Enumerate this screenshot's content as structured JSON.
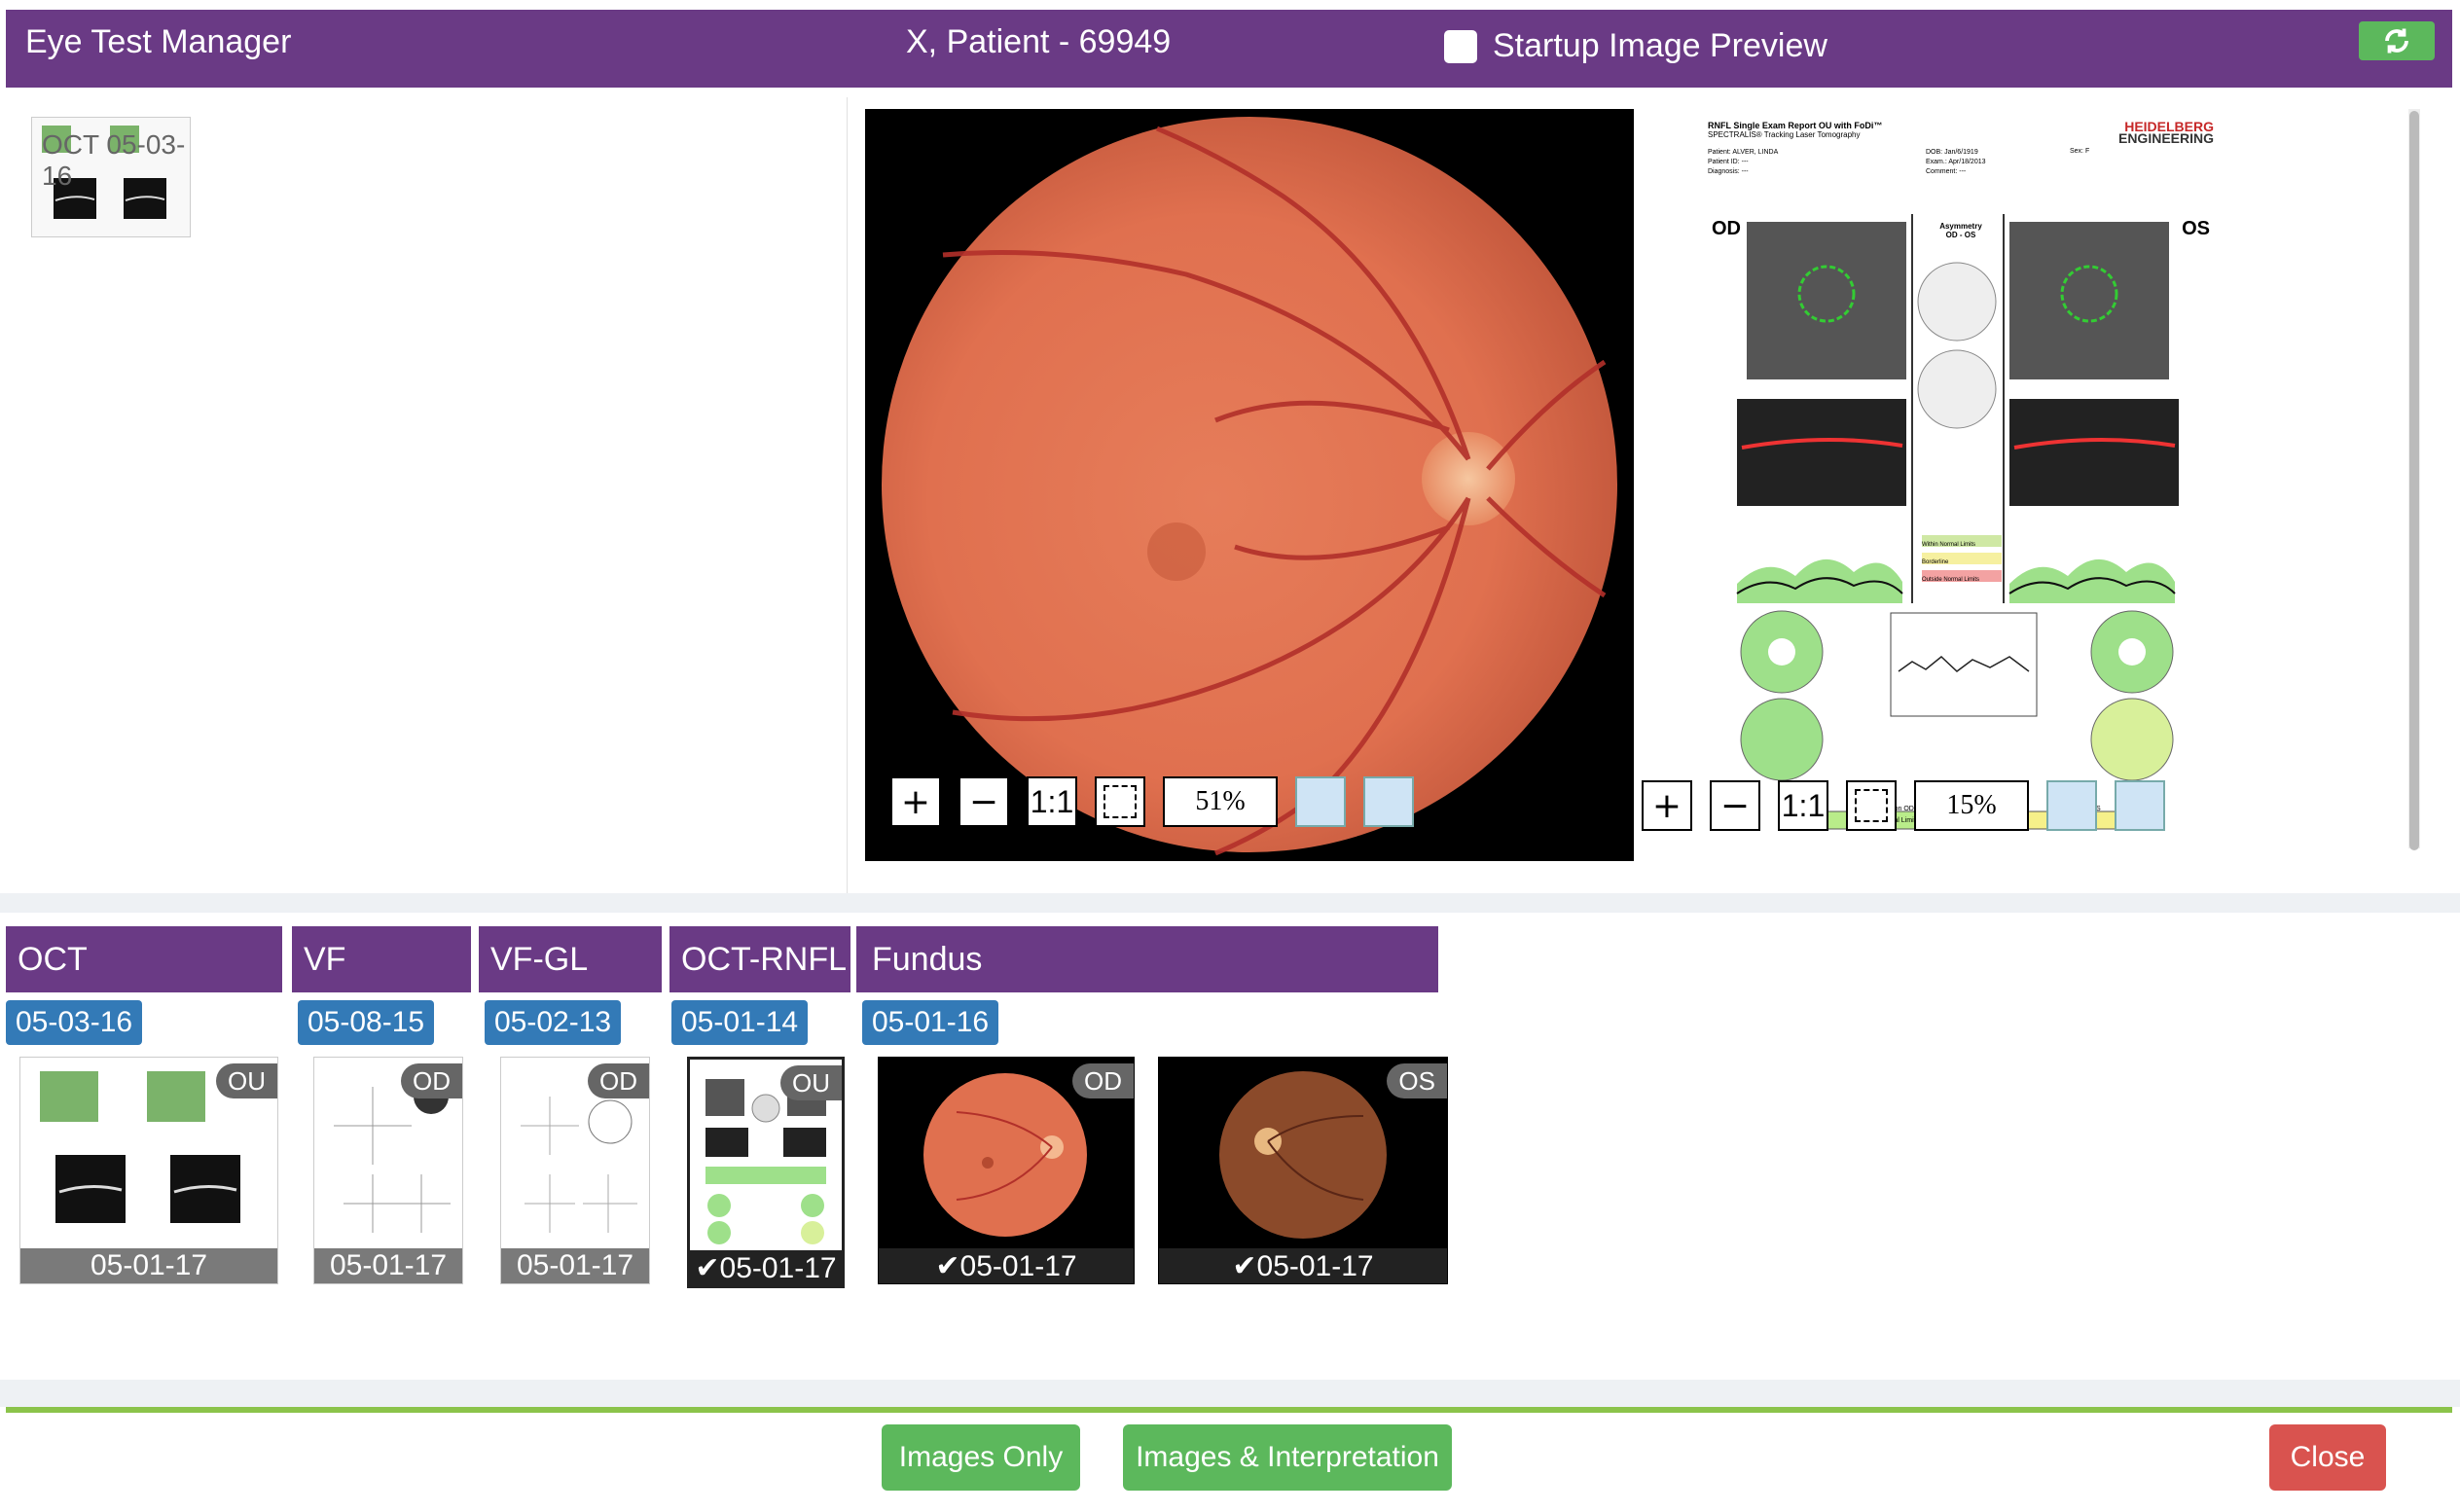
{
  "header": {
    "app_title": "Eye Test Manager",
    "patient": "X, Patient - 69949",
    "startup_preview_label": "Startup Image Preview",
    "colors": {
      "header_bg": "#6a3a85",
      "refresh_bg": "#5cb85c"
    }
  },
  "thumb_panel": {
    "doc_label": "OCT 05-03-16"
  },
  "viewer_left": {
    "zoom": "51%",
    "one_to_one": "1:1"
  },
  "viewer_right": {
    "zoom": "15%",
    "one_to_one": "1:1",
    "report": {
      "title": "RNFL Single Exam Report OU with FoDi™",
      "subtitle": "SPECTRALIS® Tracking Laser Tomography",
      "brand_line1": "HEIDELBERG",
      "brand_line2": "ENGINEERING",
      "fields": [
        {
          "label": "Patient:",
          "value": "ALVER, LINDA"
        },
        {
          "label": "Patient ID:",
          "value": "---"
        },
        {
          "label": "Diagnosis:",
          "value": "---"
        }
      ],
      "fields2": [
        {
          "label": "DOB:",
          "value": "Jan/6/1919"
        },
        {
          "label": "Exam.:",
          "value": "Apr/18/2013"
        },
        {
          "label": "Comment:",
          "value": "---"
        }
      ],
      "sex_label": "Sex:",
      "sex_value": "F",
      "od": "OD",
      "os": "OS",
      "asymmetry": "Asymmetry",
      "asymmetry_sub": "OD - OS",
      "legend_within": "Within Normal Limits",
      "legend_borderline": "Borderline",
      "legend_outside": "Outside Normal Limits",
      "class_od_label": "Classification OD",
      "class_od_value": "Within Normal Limits",
      "class_os_label": "Classification OS",
      "class_os_value": "Borderline"
    }
  },
  "tabs": [
    {
      "label": "OCT",
      "date": "05-03-16"
    },
    {
      "label": "VF",
      "date": "05-08-15"
    },
    {
      "label": "VF-GL",
      "date": "05-02-13"
    },
    {
      "label": "OCT-RNFL",
      "date": "05-01-14"
    },
    {
      "label": "Fundus",
      "date": "05-01-16"
    }
  ],
  "cards": [
    {
      "eye": "OU",
      "date": "05-01-17"
    },
    {
      "eye": "OD",
      "date": "05-01-17"
    },
    {
      "eye": "OD",
      "date": "05-01-17"
    },
    {
      "eye": "OU",
      "date": "✔05-01-17"
    },
    {
      "eye": "OD",
      "date": "✔05-01-17"
    },
    {
      "eye": "OS",
      "date": "✔05-01-17"
    }
  ],
  "footer": {
    "images_only": "Images Only",
    "images_interp": "Images & Interpretation",
    "close": "Close"
  }
}
